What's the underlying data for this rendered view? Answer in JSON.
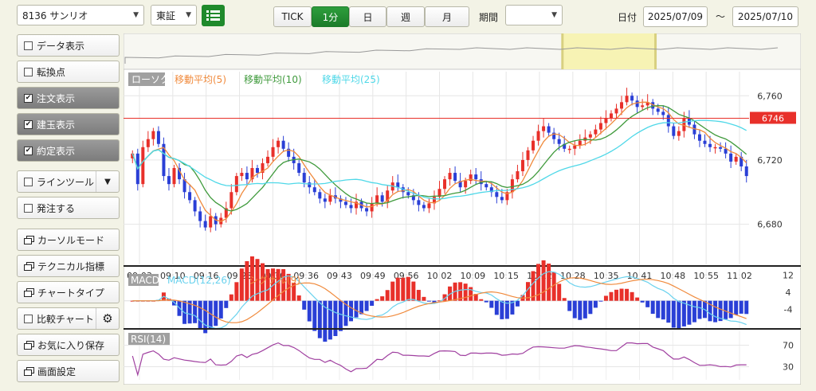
{
  "toolbar": {
    "stock": "8136 サンリオ",
    "market": "東証",
    "timeframes": [
      "TICK",
      "1分",
      "日",
      "週",
      "月"
    ],
    "active_timeframe": "1分",
    "period_label": "期間",
    "period_value": "",
    "date_label": "日付",
    "date_from": "2025/07/09",
    "tilde": "〜",
    "date_to": "2025/07/10"
  },
  "sidebar": {
    "items": [
      {
        "label": "データ表示",
        "type": "check",
        "checked": false
      },
      {
        "label": "転換点",
        "type": "check",
        "checked": false
      },
      {
        "label": "注文表示",
        "type": "check",
        "checked": true
      },
      {
        "label": "建玉表示",
        "type": "check",
        "checked": true
      },
      {
        "label": "約定表示",
        "type": "check",
        "checked": true
      },
      {
        "label": "ラインツール",
        "type": "check-dropdown",
        "checked": false
      },
      {
        "label": "発注する",
        "type": "check",
        "checked": false
      },
      {
        "label": "カーソルモード",
        "type": "window"
      },
      {
        "label": "テクニカル指標",
        "type": "window"
      },
      {
        "label": "チャートタイプ",
        "type": "window"
      },
      {
        "label": "比較チャート",
        "type": "check-gear",
        "checked": false
      },
      {
        "label": "お気に入り保存",
        "type": "window"
      },
      {
        "label": "画面設定",
        "type": "window"
      }
    ]
  },
  "colors": {
    "up": "#e8302a",
    "down": "#2a3fd6",
    "ma5": "#f08a3c",
    "ma10": "#3f9a3c",
    "ma25": "#4fd8e8",
    "macd": "#6ad2ee",
    "signal": "#f08a3c",
    "rsi": "#a040a0",
    "price_line": "#e8302a",
    "window_highlight": "#f7f3b4"
  },
  "chart_data": {
    "type": "candlestick",
    "legend": [
      "ローソク",
      "移動平均(5)",
      "移動平均(10)",
      "移動平均(25)"
    ],
    "price_ticks": [
      6760,
      6720,
      6680
    ],
    "current_price": 6746,
    "ylim": [
      6655,
      6775
    ],
    "time_labels": [
      "09:03",
      "09:10",
      "09:16",
      "09:23",
      "09:30",
      "09:36",
      "09:43",
      "09:49",
      "09:56",
      "10:02",
      "10:09",
      "10:15",
      "10:22",
      "10:28",
      "10:35",
      "10:41",
      "10:48",
      "10:55",
      "11:02"
    ],
    "closes": [
      6724,
      6705,
      6728,
      6733,
      6738,
      6730,
      6710,
      6705,
      6715,
      6708,
      6700,
      6695,
      6688,
      6682,
      6678,
      6685,
      6680,
      6684,
      6690,
      6700,
      6710,
      6712,
      6708,
      6715,
      6712,
      6718,
      6722,
      6728,
      6732,
      6727,
      6722,
      6718,
      6712,
      6706,
      6703,
      6700,
      6696,
      6694,
      6698,
      6696,
      6694,
      6692,
      6690,
      6694,
      6690,
      6688,
      6693,
      6698,
      6694,
      6701,
      6706,
      6703,
      6700,
      6698,
      6695,
      6692,
      6690,
      6693,
      6697,
      6702,
      6708,
      6712,
      6707,
      6703,
      6707,
      6711,
      6708,
      6705,
      6703,
      6700,
      6697,
      6695,
      6700,
      6708,
      6713,
      6720,
      6726,
      6732,
      6738,
      6741,
      6737,
      6733,
      6730,
      6727,
      6727,
      6729,
      6732,
      6734,
      6736,
      6739,
      6743,
      6746,
      6749,
      6752,
      6756,
      6760,
      6757,
      6753,
      6754,
      6756,
      6752,
      6750,
      6748,
      6741,
      6735,
      6738,
      6746,
      6742,
      6736,
      6732,
      6730,
      6728,
      6728,
      6727,
      6724,
      6719,
      6722,
      6716,
      6710
    ],
    "macd_panel": {
      "legend": [
        "MACD",
        "MACD(12,26)",
        "シグナル(9)"
      ],
      "ticks": [
        12,
        4,
        -4
      ]
    },
    "rsi_panel": {
      "legend": [
        "RSI(14)"
      ],
      "ticks": [
        70,
        30
      ]
    },
    "highlight_range": [
      0.72,
      0.87
    ]
  }
}
